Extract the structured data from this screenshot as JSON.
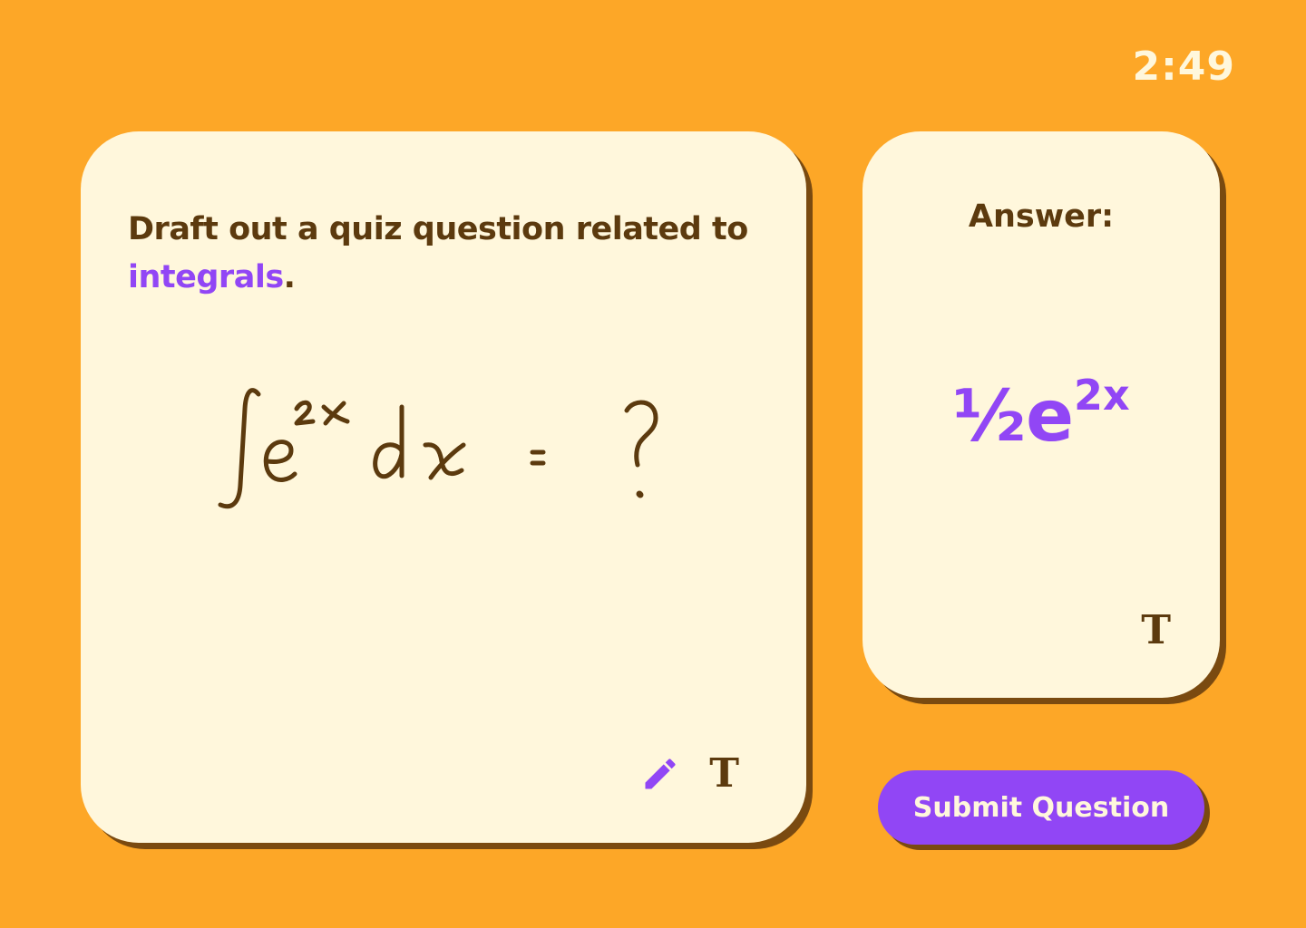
{
  "timer": "2:49",
  "question_card": {
    "prompt_text": "Draft out a quiz question related to ",
    "prompt_topic": "integrals",
    "prompt_end": ".",
    "handwritten_expression": "∫e^2x dx = ?",
    "tools": {
      "pencil_icon": "pencil-icon",
      "text_tool": "T"
    }
  },
  "answer_card": {
    "label": "Answer:",
    "value_base": "½e",
    "value_exponent": "2x",
    "tools": {
      "text_tool": "T"
    }
  },
  "submit_button": {
    "label": "Submit Question"
  },
  "colors": {
    "background": "#FDA727",
    "card": "#FFF7DC",
    "text_dark": "#5C3A0E",
    "accent": "#9146F5",
    "shadow": "#7A4A10"
  }
}
